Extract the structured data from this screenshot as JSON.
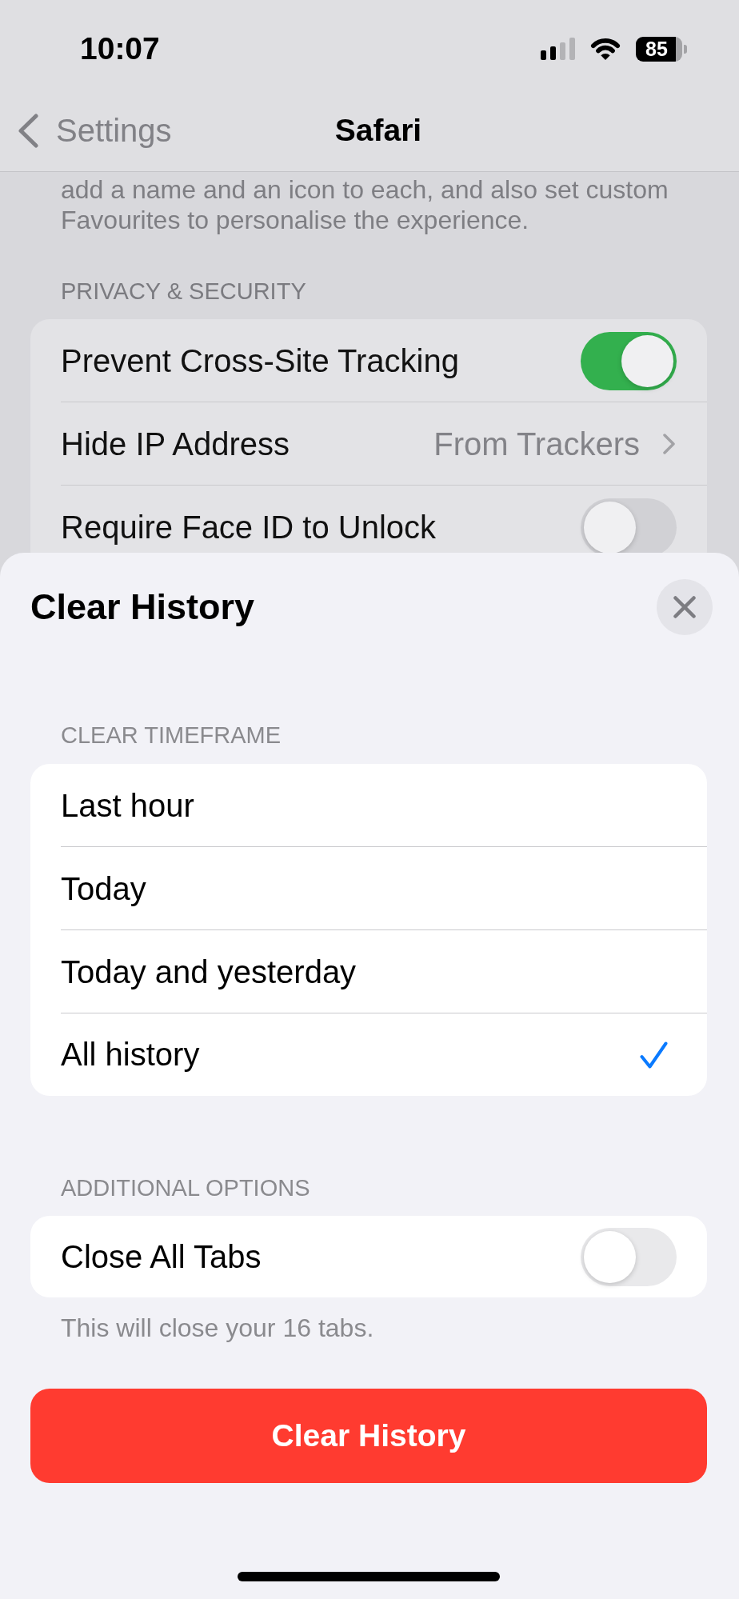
{
  "status_bar": {
    "time": "10:07",
    "battery": "85"
  },
  "nav_bar": {
    "back_label": "Settings",
    "title": "Safari"
  },
  "background_page": {
    "description_lines": [
      "add a name and an icon to each, and also set custom",
      "Favourites to personalise the experience."
    ],
    "section_header": "PRIVACY & SECURITY",
    "rows": [
      {
        "kind": "toggle",
        "label": "Prevent Cross-Site Tracking",
        "on": true
      },
      {
        "kind": "link",
        "label": "Hide IP Address",
        "value": "From Trackers"
      },
      {
        "kind": "toggle",
        "label": "Require Face ID to Unlock",
        "on": false
      }
    ]
  },
  "sheet": {
    "title": "Clear History",
    "timeframe": {
      "header": "CLEAR TIMEFRAME",
      "options": [
        {
          "label": "Last hour",
          "selected": false
        },
        {
          "label": "Today",
          "selected": false
        },
        {
          "label": "Today and yesterday",
          "selected": false
        },
        {
          "label": "All history",
          "selected": true
        }
      ]
    },
    "additional_options": {
      "header": "ADDITIONAL OPTIONS",
      "rows": [
        {
          "label": "Close All Tabs",
          "on": false
        }
      ],
      "footer": "This will close your 16 tabs."
    },
    "action_button": "Clear History"
  }
}
